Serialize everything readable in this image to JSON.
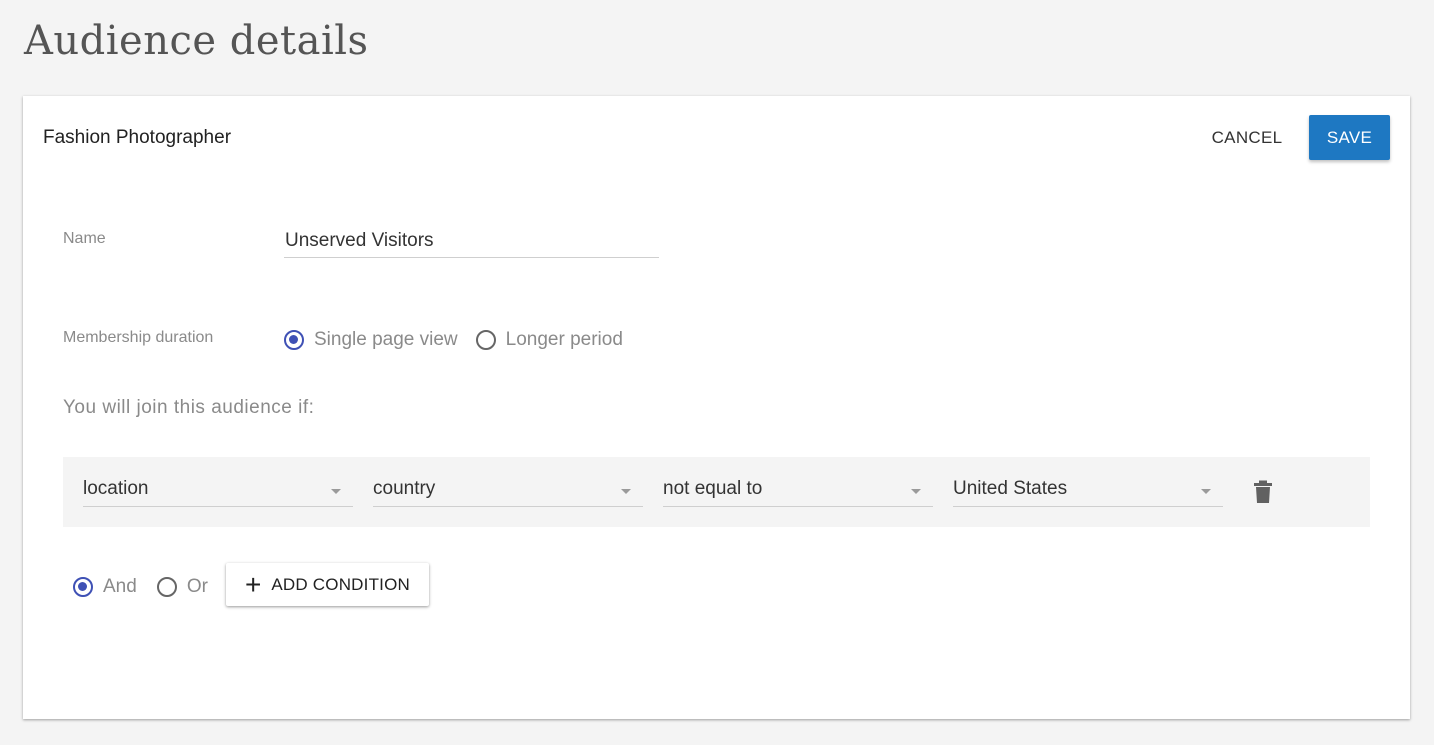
{
  "page": {
    "title": "Audience details"
  },
  "card": {
    "title": "Fashion Photographer",
    "cancel_label": "CANCEL",
    "save_label": "SAVE"
  },
  "form": {
    "name_label": "Name",
    "name_value": "Unserved Visitors",
    "membership_label": "Membership duration",
    "membership_options": [
      {
        "label": "Single page view",
        "checked": true
      },
      {
        "label": "Longer period",
        "checked": false
      }
    ],
    "join_text": "You will join this audience if:"
  },
  "condition": {
    "field": "location",
    "subfield": "country",
    "operator": "not equal to",
    "value": "United States",
    "delete_icon": "trash-icon"
  },
  "logic": {
    "options": [
      {
        "label": "And",
        "checked": true
      },
      {
        "label": "Or",
        "checked": false
      }
    ],
    "add_condition_label": "ADD CONDITION",
    "add_icon": "plus-icon"
  },
  "colors": {
    "accent": "#1e78c2",
    "radio_checked": "#3f51b5"
  }
}
